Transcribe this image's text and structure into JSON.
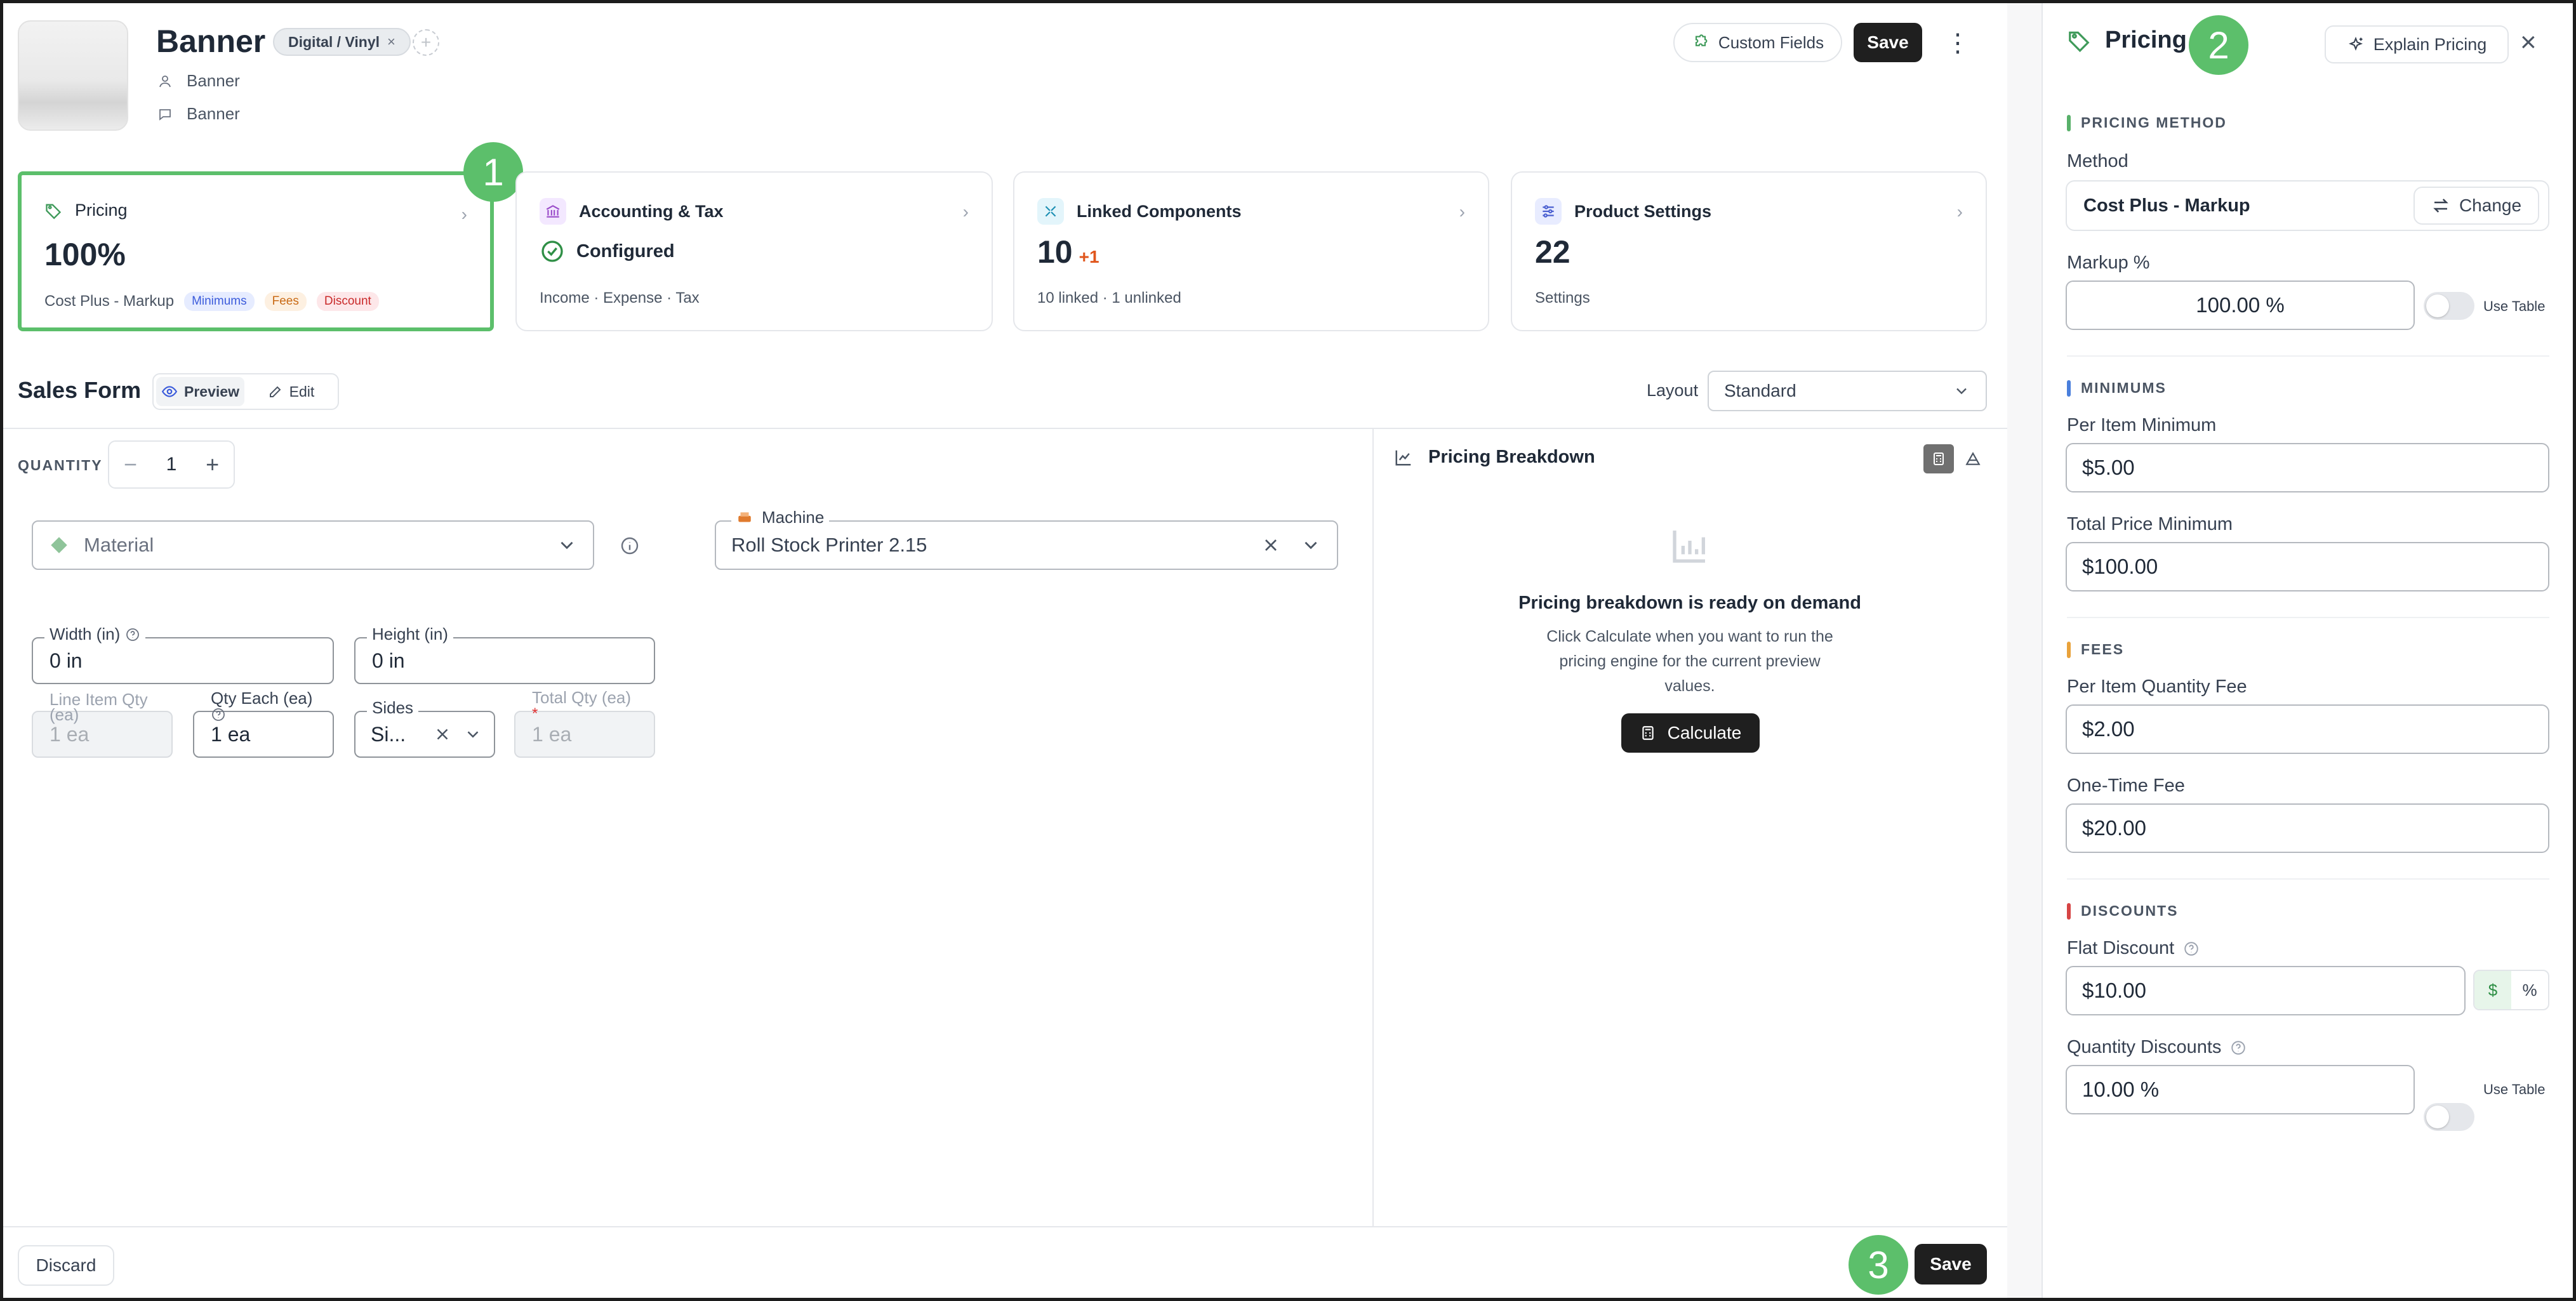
{
  "header": {
    "title": "Banner",
    "chip_label": "Digital / Vinyl",
    "chip_remove": "×",
    "chip_add": "+",
    "customer": "Banner",
    "note": "Banner",
    "custom_fields_label": "Custom Fields",
    "save_label": "Save",
    "more_label": "⋮"
  },
  "cards": {
    "pricing": {
      "title": "Pricing",
      "value": "100%",
      "method": "Cost Plus - Markup",
      "badges": [
        "Minimums",
        "Fees",
        "Discount"
      ]
    },
    "accounting": {
      "title": "Accounting & Tax",
      "status": "Configured",
      "footer": "Income · Expense · Tax"
    },
    "linked": {
      "title": "Linked Components",
      "value": "10",
      "delta": "+1",
      "footer": "10 linked · 1 unlinked"
    },
    "settings": {
      "title": "Product Settings",
      "value": "22",
      "footer": "Settings"
    }
  },
  "markers": [
    "1",
    "2",
    "3"
  ],
  "sales_form": {
    "title": "Sales Form",
    "preview_label": "Preview",
    "edit_label": "Edit",
    "layout_label": "Layout",
    "layout_value": "Standard",
    "quantity_label": "QUANTITY",
    "quantity_value": "1",
    "material_placeholder": "Material",
    "machine_label": "Machine",
    "machine_value": "Roll Stock Printer 2.15",
    "width_label": "Width (in)",
    "width_value": "0 in",
    "height_label": "Height (in)",
    "height_value": "0 in",
    "line_item_qty_label": "Line Item Qty (ea)",
    "line_item_qty_value": "1 ea",
    "qty_each_label": "Qty Each (ea)",
    "qty_each_value": "1 ea",
    "sides_label": "Sides",
    "sides_value": "Si...",
    "total_qty_label": "Total Qty (ea)",
    "total_qty_value": "1 ea",
    "total_qty_required": "*"
  },
  "breakdown": {
    "title": "Pricing Breakdown",
    "heading": "Pricing breakdown is ready on demand",
    "line1": "Click Calculate when you want to run the",
    "line2": "pricing engine for the current preview",
    "line3": "values.",
    "calculate_label": "Calculate"
  },
  "footer": {
    "discard_label": "Discard",
    "save_label": "Save"
  },
  "panel": {
    "title": "Pricing",
    "explain_label": "Explain Pricing",
    "close_label": "×",
    "method_section": "PRICING METHOD",
    "method_label": "Method",
    "method_value": "Cost Plus - Markup",
    "change_label": "Change",
    "markup_label": "Markup %",
    "markup_value": "100.00 %",
    "use_table_label": "Use Table",
    "minimums_section": "MINIMUMS",
    "per_item_min_label": "Per Item Minimum",
    "per_item_min_value": "$5.00",
    "total_min_label": "Total Price Minimum",
    "total_min_value": "$100.00",
    "fees_section": "FEES",
    "per_item_fee_label": "Per Item Quantity Fee",
    "per_item_fee_value": "$2.00",
    "one_time_fee_label": "One-Time Fee",
    "one_time_fee_value": "$20.00",
    "discounts_section": "DISCOUNTS",
    "flat_discount_label": "Flat Discount",
    "flat_discount_value": "$10.00",
    "dollar_label": "$",
    "percent_label": "%",
    "qty_discounts_label": "Quantity Discounts",
    "qty_discounts_value": "10.00 %",
    "qty_use_table_label": "Use Table"
  },
  "colors": {
    "accent_green": "#5cbf6b",
    "minimums_badge": "#e6ecff",
    "fees_badge": "#fdf0e1",
    "discount_badge": "#fde7e9",
    "method_bar": "#58b06a",
    "minimums_bar": "#4a7fdc",
    "fees_bar": "#e9a23b",
    "discounts_bar": "#d64545"
  }
}
